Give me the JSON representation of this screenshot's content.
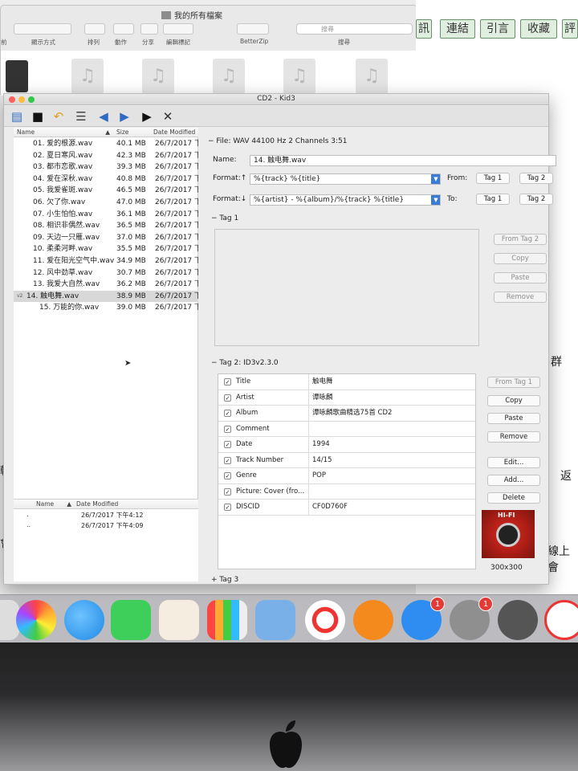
{
  "finder": {
    "title": "我的所有檔案",
    "toolbar": [
      "前",
      "顯示方式",
      "排列",
      "動作",
      "分享",
      "編輯標記",
      "BetterZip",
      "搜尋"
    ],
    "search_placeholder": "搜尋"
  },
  "web": {
    "buttons": [
      "訊",
      "連結",
      "引言",
      "收藏",
      "評"
    ],
    "text_1": "群",
    "text_2": "返",
    "text_3": "線上會"
  },
  "left_fragments": {
    "text_1": "軟",
    "text_2": "會員"
  },
  "kid3": {
    "title": "CD2 - Kid3",
    "file_columns": {
      "name": "Name",
      "size": "Size",
      "date": "Date Modified"
    },
    "files": [
      {
        "name": "01. 爱的根源.wav",
        "size": "40.1 MB",
        "date": "26/7/2017 下"
      },
      {
        "name": "02. 夏日寒风.wav",
        "size": "42.3 MB",
        "date": "26/7/2017 下"
      },
      {
        "name": "03. 都市恋歌.wav",
        "size": "39.3 MB",
        "date": "26/7/2017 下"
      },
      {
        "name": "04. 爱在深秋.wav",
        "size": "40.8 MB",
        "date": "26/7/2017 下"
      },
      {
        "name": "05. 我爱雀斑.wav",
        "size": "46.5 MB",
        "date": "26/7/2017 下"
      },
      {
        "name": "06. 欠了你.wav",
        "size": "47.0 MB",
        "date": "26/7/2017 下"
      },
      {
        "name": "07. 小生怕怕.wav",
        "size": "36.1 MB",
        "date": "26/7/2017 下"
      },
      {
        "name": "08. 相识非偶然.wav",
        "size": "36.5 MB",
        "date": "26/7/2017 下"
      },
      {
        "name": "09. 天边一只雁.wav",
        "size": "37.0 MB",
        "date": "26/7/2017 下"
      },
      {
        "name": "10. 柔柔河畔.wav",
        "size": "35.5 MB",
        "date": "26/7/2017 下"
      },
      {
        "name": "11. 爱在阳光空气中.wav",
        "size": "34.9 MB",
        "date": "26/7/2017 下"
      },
      {
        "name": "12. 风中劲草.wav",
        "size": "30.7 MB",
        "date": "26/7/2017 下"
      },
      {
        "name": "13. 我爱大自然.wav",
        "size": "36.2 MB",
        "date": "26/7/2017 下"
      },
      {
        "name": "14. 触电舞.wav",
        "size": "38.9 MB",
        "date": "26/7/2017 下",
        "marker": "v2"
      },
      {
        "name": "15. 万能的你.wav",
        "size": "39.0 MB",
        "date": "26/7/2017 下"
      }
    ],
    "dir_columns": {
      "name": "Name",
      "date": "Date Modified"
    },
    "dirs": [
      {
        "name": ".",
        "date": "26/7/2017 下午4:12"
      },
      {
        "name": "..",
        "date": "26/7/2017 下午4:09"
      }
    ],
    "file_info": "File: WAV 44100 Hz 2 Channels 3:51",
    "name_label": "Name:",
    "name_value": "14. 触电舞.wav",
    "format_up_label": "Format:↑",
    "format_up_value": "%{track} %{title}",
    "format_down_label": "Format:↓",
    "format_down_value": "%{artist} - %{album}/%{track} %{title}",
    "from_label": "From:",
    "to_label": "To:",
    "tag1_btn": "Tag 1",
    "tag2_btn": "Tag 2",
    "tag1_header": "Tag 1",
    "tag1_buttons": [
      "From Tag 2",
      "Copy",
      "Paste",
      "Remove"
    ],
    "tag2_header": "Tag 2: ID3v2.3.0",
    "tag2_frames": [
      {
        "name": "Title",
        "value": "触电舞"
      },
      {
        "name": "Artist",
        "value": "谭咏麟"
      },
      {
        "name": "Album",
        "value": "谭咏麟歌曲精选75首 CD2"
      },
      {
        "name": "Comment",
        "value": ""
      },
      {
        "name": "Date",
        "value": "1994"
      },
      {
        "name": "Track Number",
        "value": "14/15"
      },
      {
        "name": "Genre",
        "value": "POP"
      },
      {
        "name": "Picture: Cover (fro...",
        "value": ""
      },
      {
        "name": "DISCID",
        "value": "CF0D760F"
      }
    ],
    "tag2_buttons": [
      "From Tag 1",
      "Copy",
      "Paste",
      "Remove"
    ],
    "frame_buttons": [
      "Edit...",
      "Add...",
      "Delete"
    ],
    "cover_text": "HI-FI",
    "cover_size": "300x300",
    "tag3_header": "Tag 3"
  },
  "dock": {
    "badges": [
      "1",
      "1"
    ]
  },
  "colors": {
    "accent": "#3a7bd5",
    "badge": "#e53935",
    "web_button": "#dfeedf"
  }
}
